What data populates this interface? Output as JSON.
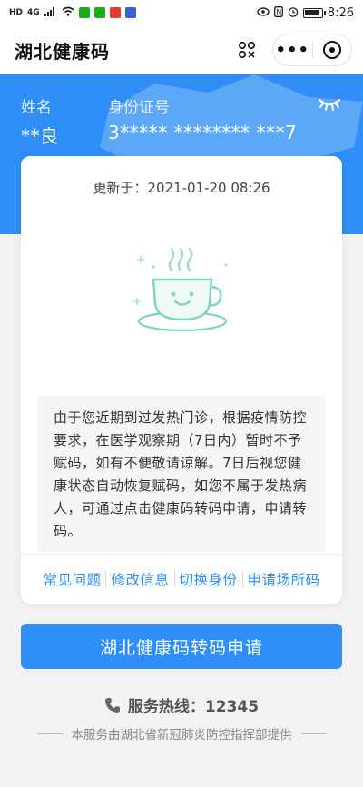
{
  "status_bar": {
    "left_indicators": [
      "HD",
      "4G"
    ],
    "time": "8:26"
  },
  "nav": {
    "title": "湖北健康码",
    "more_label": "•••"
  },
  "header": {
    "name_label": "姓名",
    "name_value": "**良",
    "id_label": "身份证号",
    "id_value": "3***** ******** ***7"
  },
  "card": {
    "update_time": "更新于：2021-01-20 08:26",
    "notice_text": "由于您近期到过发热门诊，根据疫情防控要求，在医学观察期（7日内）暂时不予赋码，如有不便敬请谅解。7日后视您健康状态自动恢复赋码，如您不属于发热病人，可通过点击健康码转码申请，申请转码。",
    "links": [
      {
        "label": "常见问题"
      },
      {
        "label": "修改信息"
      },
      {
        "label": "切换身份"
      },
      {
        "label": "申请场所码"
      }
    ]
  },
  "apply_button": "湖北健康码转码申请",
  "hotline": "服务热线：12345",
  "footer": "本服务由湖北省新冠肺炎防控指挥部提供",
  "colors": {
    "primary": "#2f8ef7",
    "cup": "#7ed3c2"
  },
  "icons": {
    "scan": "scan-icon",
    "close": "close-circle-icon",
    "eye": "eye-closed-icon",
    "cup": "coffee-cup-icon",
    "phone": "phone-icon"
  }
}
